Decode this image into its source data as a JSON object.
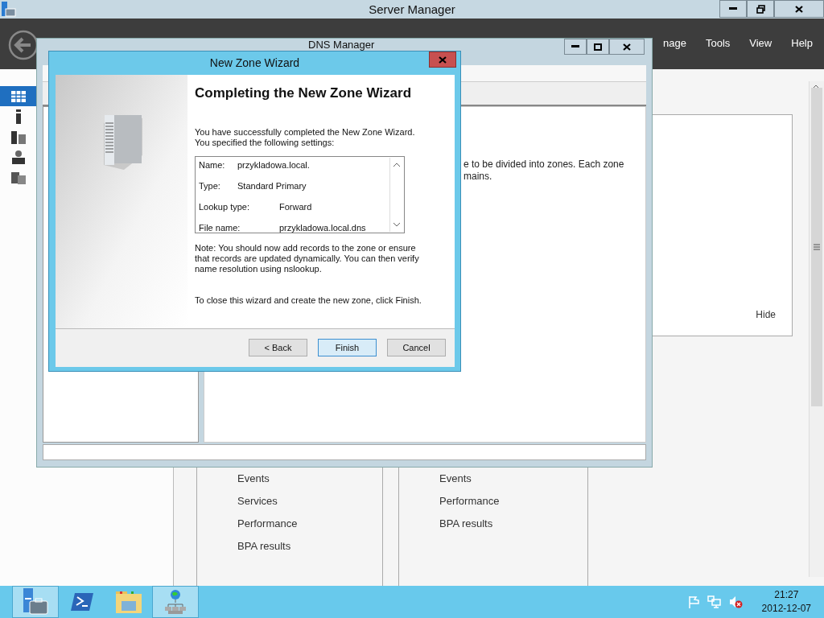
{
  "server_manager": {
    "title": "Server Manager",
    "menu": [
      "nage",
      "Tools",
      "View",
      "Help"
    ],
    "sidebar": [
      {
        "selected": true
      },
      {
        "selected": false
      },
      {
        "selected": false
      },
      {
        "selected": false
      },
      {
        "selected": false
      }
    ],
    "panel_action": "Hide",
    "tiles": [
      {
        "items": [
          "Events",
          "Services",
          "Performance",
          "BPA results"
        ]
      },
      {
        "items": [
          "Events",
          "Performance",
          "BPA results"
        ]
      }
    ]
  },
  "dns_manager": {
    "title": "DNS Manager",
    "text_lines": [
      "e to be divided into zones. Each zone",
      "mains."
    ]
  },
  "wizard": {
    "title": "New Zone Wizard",
    "heading": "Completing the New Zone Wizard",
    "intro": "You have successfully completed the New Zone Wizard. You specified the following settings:",
    "settings": [
      {
        "label": "Name:",
        "value": "przykladowa.local."
      },
      {
        "label": "Type:",
        "value": "Standard Primary"
      },
      {
        "label": "Lookup type:",
        "value": "Forward"
      },
      {
        "label": "File name:",
        "value": "przykladowa.local.dns"
      }
    ],
    "note": "Note: You should now add records to the zone or ensure that records are updated dynamically. You can then verify name resolution using nslookup.",
    "closing": "To close this wizard and create the new zone, click Finish.",
    "buttons": [
      {
        "label": "< Back",
        "default": false
      },
      {
        "label": "Finish",
        "default": true
      },
      {
        "label": "Cancel",
        "default": false
      }
    ]
  },
  "taskbar": {
    "apps": [
      {
        "kind": "server",
        "highlighted": true
      },
      {
        "kind": "shell",
        "highlighted": false
      },
      {
        "kind": "folder",
        "highlighted": false
      },
      {
        "kind": "dns",
        "highlighted": true
      }
    ],
    "time": "21:27",
    "date": "2012-12-07"
  }
}
